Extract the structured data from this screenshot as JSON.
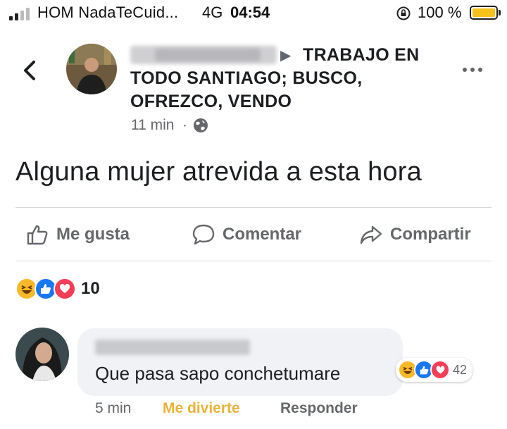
{
  "status_bar": {
    "carrier": "HOM NadaTeCuid...",
    "network": "4G",
    "time": "04:54",
    "battery_pct": "100 %",
    "battery_level": 1.0,
    "battery_color": "#f6c21b"
  },
  "post": {
    "group_name": "TRABAJO EN TODO SANTIAGO; BUSCO, OFREZCO, VENDO",
    "time": "11 min",
    "separator": "·",
    "privacy_icon": "globe-icon",
    "text": "Alguna mujer atrevida a esta hora"
  },
  "actions": {
    "like": "Me gusta",
    "comment": "Comentar",
    "share": "Compartir"
  },
  "reactions": {
    "types": [
      "haha",
      "like",
      "love"
    ],
    "count": "10"
  },
  "comment": {
    "text": "Que pasa sapo conchetumare",
    "reaction_types": [
      "haha",
      "like",
      "love"
    ],
    "reaction_count": "42",
    "time": "5 min",
    "like_label": "Me divierte",
    "reply_label": "Responder"
  },
  "colors": {
    "secondary_text": "#65676b",
    "haha_label": "#e9b23a",
    "like_blue": "#1877f2",
    "love_red": "#f33e58",
    "haha_yellow": "#f7b928"
  }
}
